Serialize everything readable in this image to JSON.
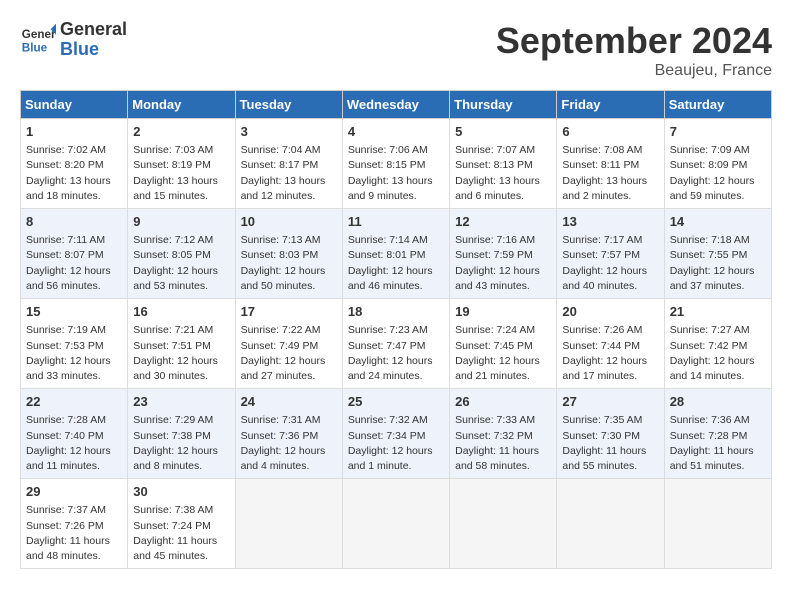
{
  "header": {
    "logo_general": "General",
    "logo_blue": "Blue",
    "title": "September 2024",
    "location": "Beaujeu, France"
  },
  "columns": [
    "Sunday",
    "Monday",
    "Tuesday",
    "Wednesday",
    "Thursday",
    "Friday",
    "Saturday"
  ],
  "weeks": [
    [
      {
        "day": "1",
        "info": "Sunrise: 7:02 AM\nSunset: 8:20 PM\nDaylight: 13 hours\nand 18 minutes."
      },
      {
        "day": "2",
        "info": "Sunrise: 7:03 AM\nSunset: 8:19 PM\nDaylight: 13 hours\nand 15 minutes."
      },
      {
        "day": "3",
        "info": "Sunrise: 7:04 AM\nSunset: 8:17 PM\nDaylight: 13 hours\nand 12 minutes."
      },
      {
        "day": "4",
        "info": "Sunrise: 7:06 AM\nSunset: 8:15 PM\nDaylight: 13 hours\nand 9 minutes."
      },
      {
        "day": "5",
        "info": "Sunrise: 7:07 AM\nSunset: 8:13 PM\nDaylight: 13 hours\nand 6 minutes."
      },
      {
        "day": "6",
        "info": "Sunrise: 7:08 AM\nSunset: 8:11 PM\nDaylight: 13 hours\nand 2 minutes."
      },
      {
        "day": "7",
        "info": "Sunrise: 7:09 AM\nSunset: 8:09 PM\nDaylight: 12 hours\nand 59 minutes."
      }
    ],
    [
      {
        "day": "8",
        "info": "Sunrise: 7:11 AM\nSunset: 8:07 PM\nDaylight: 12 hours\nand 56 minutes."
      },
      {
        "day": "9",
        "info": "Sunrise: 7:12 AM\nSunset: 8:05 PM\nDaylight: 12 hours\nand 53 minutes."
      },
      {
        "day": "10",
        "info": "Sunrise: 7:13 AM\nSunset: 8:03 PM\nDaylight: 12 hours\nand 50 minutes."
      },
      {
        "day": "11",
        "info": "Sunrise: 7:14 AM\nSunset: 8:01 PM\nDaylight: 12 hours\nand 46 minutes."
      },
      {
        "day": "12",
        "info": "Sunrise: 7:16 AM\nSunset: 7:59 PM\nDaylight: 12 hours\nand 43 minutes."
      },
      {
        "day": "13",
        "info": "Sunrise: 7:17 AM\nSunset: 7:57 PM\nDaylight: 12 hours\nand 40 minutes."
      },
      {
        "day": "14",
        "info": "Sunrise: 7:18 AM\nSunset: 7:55 PM\nDaylight: 12 hours\nand 37 minutes."
      }
    ],
    [
      {
        "day": "15",
        "info": "Sunrise: 7:19 AM\nSunset: 7:53 PM\nDaylight: 12 hours\nand 33 minutes."
      },
      {
        "day": "16",
        "info": "Sunrise: 7:21 AM\nSunset: 7:51 PM\nDaylight: 12 hours\nand 30 minutes."
      },
      {
        "day": "17",
        "info": "Sunrise: 7:22 AM\nSunset: 7:49 PM\nDaylight: 12 hours\nand 27 minutes."
      },
      {
        "day": "18",
        "info": "Sunrise: 7:23 AM\nSunset: 7:47 PM\nDaylight: 12 hours\nand 24 minutes."
      },
      {
        "day": "19",
        "info": "Sunrise: 7:24 AM\nSunset: 7:45 PM\nDaylight: 12 hours\nand 21 minutes."
      },
      {
        "day": "20",
        "info": "Sunrise: 7:26 AM\nSunset: 7:44 PM\nDaylight: 12 hours\nand 17 minutes."
      },
      {
        "day": "21",
        "info": "Sunrise: 7:27 AM\nSunset: 7:42 PM\nDaylight: 12 hours\nand 14 minutes."
      }
    ],
    [
      {
        "day": "22",
        "info": "Sunrise: 7:28 AM\nSunset: 7:40 PM\nDaylight: 12 hours\nand 11 minutes."
      },
      {
        "day": "23",
        "info": "Sunrise: 7:29 AM\nSunset: 7:38 PM\nDaylight: 12 hours\nand 8 minutes."
      },
      {
        "day": "24",
        "info": "Sunrise: 7:31 AM\nSunset: 7:36 PM\nDaylight: 12 hours\nand 4 minutes."
      },
      {
        "day": "25",
        "info": "Sunrise: 7:32 AM\nSunset: 7:34 PM\nDaylight: 12 hours\nand 1 minute."
      },
      {
        "day": "26",
        "info": "Sunrise: 7:33 AM\nSunset: 7:32 PM\nDaylight: 11 hours\nand 58 minutes."
      },
      {
        "day": "27",
        "info": "Sunrise: 7:35 AM\nSunset: 7:30 PM\nDaylight: 11 hours\nand 55 minutes."
      },
      {
        "day": "28",
        "info": "Sunrise: 7:36 AM\nSunset: 7:28 PM\nDaylight: 11 hours\nand 51 minutes."
      }
    ],
    [
      {
        "day": "29",
        "info": "Sunrise: 7:37 AM\nSunset: 7:26 PM\nDaylight: 11 hours\nand 48 minutes."
      },
      {
        "day": "30",
        "info": "Sunrise: 7:38 AM\nSunset: 7:24 PM\nDaylight: 11 hours\nand 45 minutes."
      },
      null,
      null,
      null,
      null,
      null
    ]
  ]
}
